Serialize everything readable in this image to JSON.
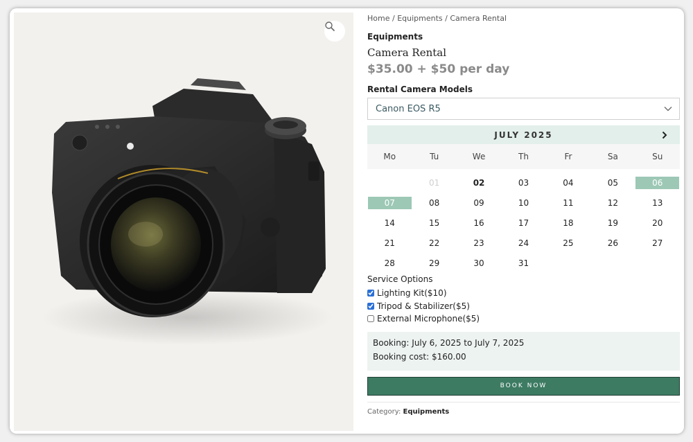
{
  "breadcrumb": [
    {
      "label": "Home"
    },
    {
      "label": "Equipments"
    },
    {
      "label": "Camera Rental"
    }
  ],
  "breadcrumb_separator": " / ",
  "product": {
    "category_top": "Equipments",
    "title": "Camera Rental",
    "price": "$35.00 + $50 per day",
    "image_icon": "camera-photo"
  },
  "models": {
    "label": "Rental Camera Models",
    "selected": "Canon EOS R5"
  },
  "calendar": {
    "month_label": "JULY 2025",
    "weekdays": [
      "Mo",
      "Tu",
      "We",
      "Th",
      "Fr",
      "Sa",
      "Su"
    ],
    "leading_blanks": 1,
    "days": [
      {
        "d": "01",
        "state": "past"
      },
      {
        "d": "02",
        "state": "bold"
      },
      {
        "d": "03"
      },
      {
        "d": "04"
      },
      {
        "d": "05"
      },
      {
        "d": "06",
        "state": "selected"
      },
      {
        "d": "07",
        "state": "selected"
      },
      {
        "d": "08"
      },
      {
        "d": "09"
      },
      {
        "d": "10"
      },
      {
        "d": "11"
      },
      {
        "d": "12"
      },
      {
        "d": "13"
      },
      {
        "d": "14"
      },
      {
        "d": "15"
      },
      {
        "d": "16"
      },
      {
        "d": "17"
      },
      {
        "d": "18"
      },
      {
        "d": "19"
      },
      {
        "d": "20"
      },
      {
        "d": "21"
      },
      {
        "d": "22"
      },
      {
        "d": "23"
      },
      {
        "d": "24"
      },
      {
        "d": "25"
      },
      {
        "d": "26"
      },
      {
        "d": "27"
      },
      {
        "d": "28"
      },
      {
        "d": "29"
      },
      {
        "d": "30"
      },
      {
        "d": "31"
      }
    ]
  },
  "services": {
    "label": "Service Options",
    "items": [
      {
        "label": "Lighting Kit($10)",
        "checked": true
      },
      {
        "label": "Tripod & Stabilizer($5)",
        "checked": true
      },
      {
        "label": "External Microphone($5)",
        "checked": false
      }
    ]
  },
  "booking": {
    "dates": "Booking: July 6, 2025 to July 7, 2025",
    "cost": "Booking cost: $160.00"
  },
  "book_button": "BOOK NOW",
  "meta": {
    "category_label": "Category:",
    "category_value": "Equipments"
  },
  "colors": {
    "accent": "#3d7b63",
    "selected_day": "#9dc8b6",
    "calendar_header": "#e2efea",
    "price": "#8a8a8a"
  }
}
